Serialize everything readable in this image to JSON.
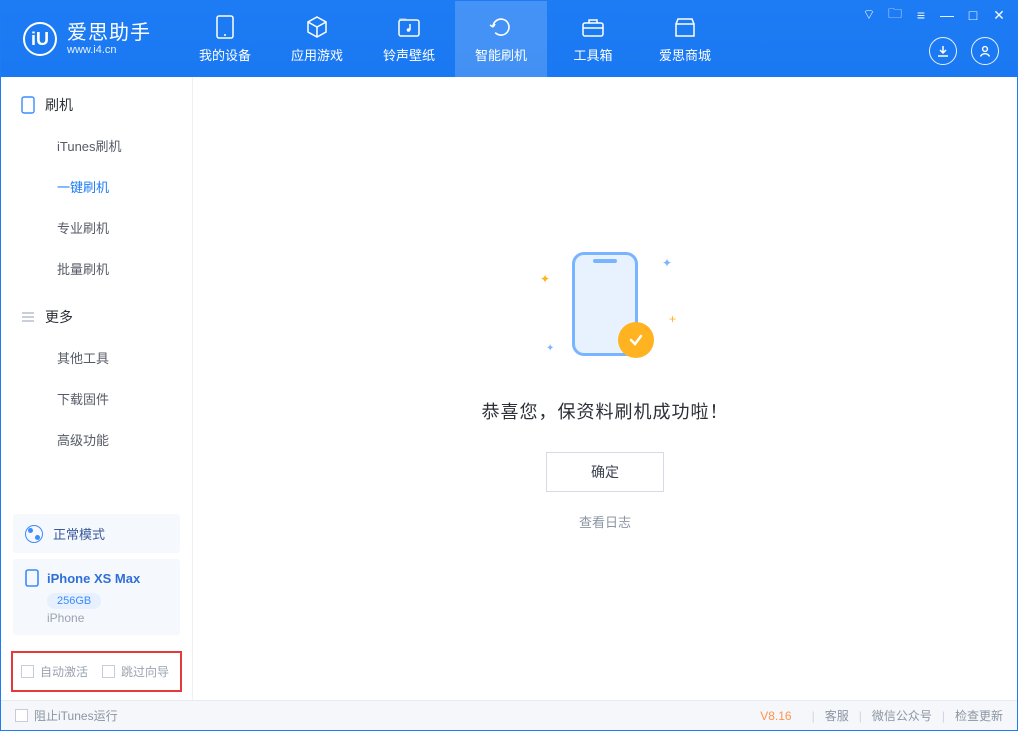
{
  "app": {
    "title": "爱思助手",
    "url": "www.i4.cn"
  },
  "nav": {
    "mydevice": "我的设备",
    "apps": "应用游戏",
    "ringtones": "铃声壁纸",
    "flash": "智能刷机",
    "toolbox": "工具箱",
    "store": "爱思商城"
  },
  "sidebar": {
    "section_flash": "刷机",
    "itunes_flash": "iTunes刷机",
    "one_click": "一键刷机",
    "pro_flash": "专业刷机",
    "batch_flash": "批量刷机",
    "section_more": "更多",
    "other_tools": "其他工具",
    "download_fw": "下载固件",
    "advanced": "高级功能"
  },
  "mode_label": "正常模式",
  "device": {
    "name": "iPhone XS Max",
    "capacity": "256GB",
    "type": "iPhone"
  },
  "checkbox": {
    "auto_activate": "自动激活",
    "skip_guide": "跳过向导"
  },
  "main": {
    "success_msg": "恭喜您，保资料刷机成功啦！",
    "ok": "确定",
    "view_log": "查看日志"
  },
  "footer": {
    "block_itunes": "阻止iTunes运行",
    "version": "V8.16",
    "support": "客服",
    "wechat": "微信公众号",
    "check_update": "检查更新"
  }
}
